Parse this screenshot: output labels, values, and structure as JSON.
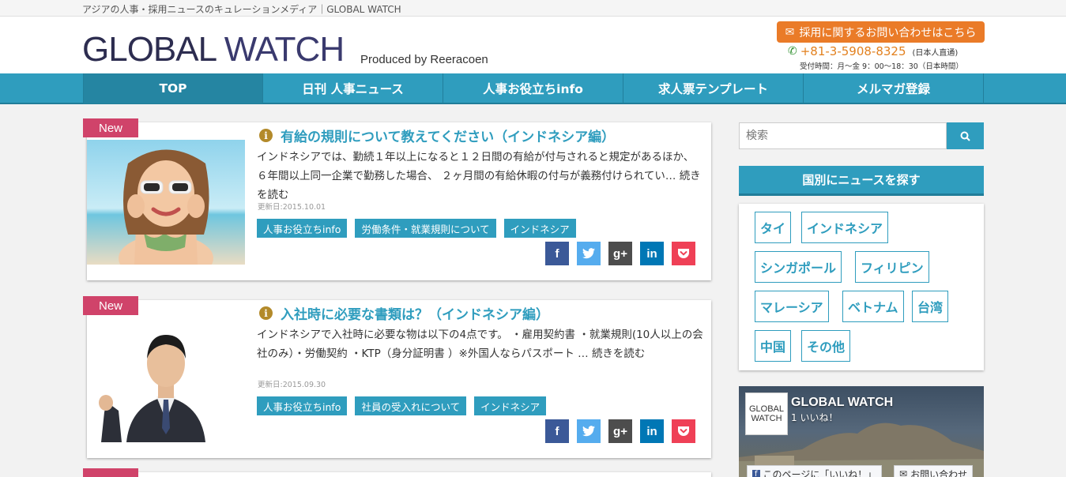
{
  "top_strip": "アジアの人事・採用ニュースのキュレーションメディア｜GLOBAL WATCH",
  "header": {
    "logo_part1": "GLOBAL ",
    "logo_part2": "WATCH",
    "produced_by": "Produced by Reeracoen",
    "contact_button": "採用に関するお問い合わせはこちら",
    "phone": "+81-3-5908-8325",
    "phone_note": "(日本人直通)",
    "hours": "受付時間：月〜金 9：00〜18：30（日本時間）"
  },
  "nav": [
    "TOP",
    "日刊 人事ニュース",
    "人事お役立ちinfo",
    "求人票テンプレート",
    "メルマガ登録"
  ],
  "posts": [
    {
      "badge": "New",
      "title": "有給の規則について教えてください（インドネシア編）",
      "excerpt": "インドネシアでは、勤続１年以上になると１２日間の有給が付与されると規定があるほか、 ６年間以上同一企業で勤務した場合、 ２ヶ月間の有給休暇の付与が義務付けられてい…",
      "read_more": "続きを読む",
      "date": "更新日:2015.10.01",
      "tags": [
        "人事お役立ちinfo",
        "労働条件・就業規則について",
        "インドネシア"
      ]
    },
    {
      "badge": "New",
      "title": "入社時に必要な書類は？（インドネシア編）",
      "excerpt": "インドネシアで入社時に必要な物は以下の4点です。 ・雇用契約書 ・就業規則(10人以上の会社のみ）・労働契約 ・KTP（身分証明書 ）※外国人ならパスポート …",
      "read_more": "続きを読む",
      "date": "更新日:2015.09.30",
      "tags": [
        "人事お役立ちinfo",
        "社員の受入れについて",
        "インドネシア"
      ]
    }
  ],
  "share": {
    "facebook": "f",
    "twitter": "t",
    "googleplus": "g+",
    "linkedin": "in",
    "pocket": "p"
  },
  "sidebar": {
    "search_placeholder": "検索",
    "country_heading": "国別にニュースを探す",
    "countries": [
      "タイ",
      "インドネシア",
      "シンガポール",
      "フィリピン",
      "マレーシア",
      "ベトナム",
      "台湾",
      "中国",
      "その他"
    ],
    "facebook": {
      "page_name": "GLOBAL WATCH",
      "likes": "1 いいね！",
      "logo_line1": "GLOBAL",
      "logo_line2": "WATCH",
      "like_button": "このページに「いいね！」",
      "contact_button": "お問い合わせ"
    }
  },
  "colors": {
    "accent": "#2f9dbe",
    "new_badge": "#d0436a",
    "contact": "#ea7b28"
  }
}
